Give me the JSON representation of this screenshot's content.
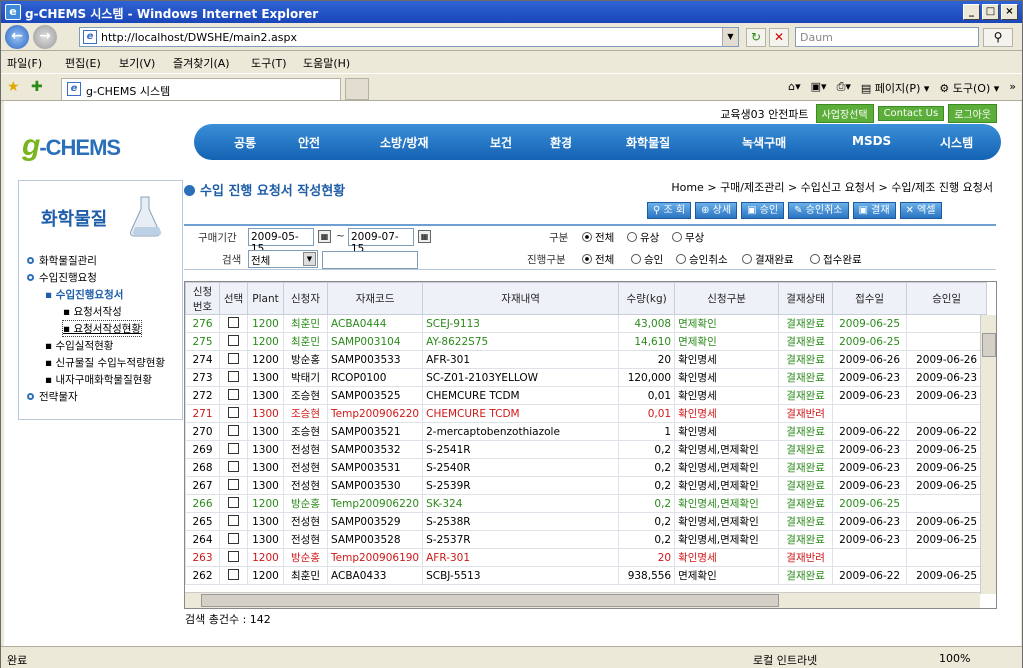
{
  "window": {
    "title": "g-CHEMS 시스템 - Windows Internet Explorer"
  },
  "browser": {
    "url": "http://localhost/DWSHE/main2.aspx",
    "search_placeholder": "Daum",
    "tab_title": "g-CHEMS 시스템",
    "menu": [
      "파일(F)",
      "편집(E)",
      "보기(V)",
      "즐겨찾기(A)",
      "도구(T)",
      "도움말(H)"
    ],
    "cmd": [
      "페이지(P)",
      "도구(O)"
    ],
    "status": "완료",
    "zone": "로컬 인트라넷",
    "zoom": "100%"
  },
  "site": {
    "user": "교육생03 안전파트",
    "btn_site": "사업장선택",
    "btn_contact": "Contact Us",
    "btn_logout": "로그아웃",
    "logo_g": "g",
    "logo_rest": "-CHEMS",
    "nav": [
      "공통",
      "안전",
      "소방/방재",
      "보건",
      "환경",
      "화학물질",
      "녹색구매",
      "MSDS",
      "시스템"
    ]
  },
  "left": {
    "title": "화학물질",
    "items": [
      "화학물질관리",
      "수입진행요청",
      "수입진행요청서",
      "요청서작성",
      "요청서작성현황",
      "수입실적현황",
      "신규물질 수입누적량현황",
      "내자구매화학물질현황",
      "전략물자"
    ]
  },
  "page": {
    "title": "수입 진행 요청서 작성현황",
    "breadcrumb": "Home > 구매/제조관리 > 수입신고 요청서 > 수입/제조 진행 요청서",
    "buttons": [
      "조 회",
      "상세",
      "승인",
      "승인취소",
      "결재",
      "엑셀"
    ]
  },
  "filter": {
    "period_label": "구매기간",
    "date_from": "2009-05-15",
    "tilde": "~",
    "date_to": "2009-07-15",
    "search_label": "검색",
    "search_sel": "전체",
    "kind_label": "구분",
    "kind_opts": [
      "전체",
      "유상",
      "무상"
    ],
    "progress_label": "진행구분",
    "progress_opts": [
      "전체",
      "승인",
      "승인취소",
      "결재완료",
      "접수완료"
    ]
  },
  "grid": {
    "headers": [
      "신청\n번호",
      "선택",
      "Plant",
      "신청자",
      "자재코드",
      "자재내역",
      "수량(kg)",
      "신청구분",
      "결재상태",
      "접수일",
      "승인일"
    ],
    "rows": [
      {
        "no": "276",
        "plant": "1200",
        "user": "최훈민",
        "code": "ACBA0444",
        "desc": "SCEJ-9113",
        "qty": "43,008",
        "kind": "면제확인",
        "status": "결재완료",
        "recv": "2009-06-25",
        "appr": "",
        "color": "green"
      },
      {
        "no": "275",
        "plant": "1200",
        "user": "최훈민",
        "code": "SAMP003104",
        "desc": "AY-8622S75",
        "qty": "14,610",
        "kind": "면제확인",
        "status": "결재완료",
        "recv": "2009-06-25",
        "appr": "",
        "color": "green"
      },
      {
        "no": "274",
        "plant": "1200",
        "user": "방순홍",
        "code": "SAMP003533",
        "desc": "AFR-301",
        "qty": "20",
        "kind": "확인명세",
        "status": "결재완료",
        "recv": "2009-06-26",
        "appr": "2009-06-26",
        "color": ""
      },
      {
        "no": "273",
        "plant": "1300",
        "user": "박태기",
        "code": "RCOP0100",
        "desc": "SC-Z01-2103YELLOW",
        "qty": "120,000",
        "kind": "확인명세",
        "status": "결재완료",
        "recv": "2009-06-23",
        "appr": "2009-06-23",
        "color": ""
      },
      {
        "no": "272",
        "plant": "1300",
        "user": "조승현",
        "code": "SAMP003525",
        "desc": "CHEMCURE TCDM",
        "qty": "0,01",
        "kind": "확인명세",
        "status": "결재완료",
        "recv": "2009-06-23",
        "appr": "2009-06-23",
        "color": ""
      },
      {
        "no": "271",
        "plant": "1300",
        "user": "조승현",
        "code": "Temp200906220",
        "desc": "CHEMCURE TCDM",
        "qty": "0,01",
        "kind": "확인명세",
        "status": "결재반려",
        "recv": "",
        "appr": "",
        "color": "red"
      },
      {
        "no": "270",
        "plant": "1300",
        "user": "조승현",
        "code": "SAMP003521",
        "desc": "2-mercaptobenzothiazole",
        "qty": "1",
        "kind": "확인명세",
        "status": "결재완료",
        "recv": "2009-06-22",
        "appr": "2009-06-22",
        "color": ""
      },
      {
        "no": "269",
        "plant": "1300",
        "user": "전성현",
        "code": "SAMP003532",
        "desc": "S-2541R",
        "qty": "0,2",
        "kind": "확인명세,면제확인",
        "status": "결재완료",
        "recv": "2009-06-23",
        "appr": "2009-06-25",
        "color": ""
      },
      {
        "no": "268",
        "plant": "1300",
        "user": "전성현",
        "code": "SAMP003531",
        "desc": "S-2540R",
        "qty": "0,2",
        "kind": "확인명세,면제확인",
        "status": "결재완료",
        "recv": "2009-06-23",
        "appr": "2009-06-25",
        "color": ""
      },
      {
        "no": "267",
        "plant": "1300",
        "user": "전성현",
        "code": "SAMP003530",
        "desc": "S-2539R",
        "qty": "0,2",
        "kind": "확인명세,면제확인",
        "status": "결재완료",
        "recv": "2009-06-23",
        "appr": "2009-06-25",
        "color": ""
      },
      {
        "no": "266",
        "plant": "1200",
        "user": "방순홍",
        "code": "Temp200906220",
        "desc": "SK-324",
        "qty": "0,2",
        "kind": "확인명세,면제확인",
        "status": "결재완료",
        "recv": "2009-06-25",
        "appr": "",
        "color": "green"
      },
      {
        "no": "265",
        "plant": "1300",
        "user": "전성현",
        "code": "SAMP003529",
        "desc": "S-2538R",
        "qty": "0,2",
        "kind": "확인명세,면제확인",
        "status": "결재완료",
        "recv": "2009-06-23",
        "appr": "2009-06-25",
        "color": ""
      },
      {
        "no": "264",
        "plant": "1300",
        "user": "전성현",
        "code": "SAMP003528",
        "desc": "S-2537R",
        "qty": "0,2",
        "kind": "확인명세,면제확인",
        "status": "결재완료",
        "recv": "2009-06-23",
        "appr": "2009-06-25",
        "color": ""
      },
      {
        "no": "263",
        "plant": "1200",
        "user": "방순홍",
        "code": "Temp200906190",
        "desc": "AFR-301",
        "qty": "20",
        "kind": "확인명세",
        "status": "결재반려",
        "recv": "",
        "appr": "",
        "color": "red"
      },
      {
        "no": "262",
        "plant": "1200",
        "user": "최훈민",
        "code": "ACBA0433",
        "desc": "SCBJ-5513",
        "qty": "938,556",
        "kind": "면제확인",
        "status": "결재완료",
        "recv": "2009-06-22",
        "appr": "2009-06-25",
        "color": ""
      }
    ],
    "total": "검색 총건수 : 142"
  },
  "colors": {
    "nav": "#1f6fc0",
    "accent_green": "#2a8a1a",
    "red": "#d01818"
  }
}
